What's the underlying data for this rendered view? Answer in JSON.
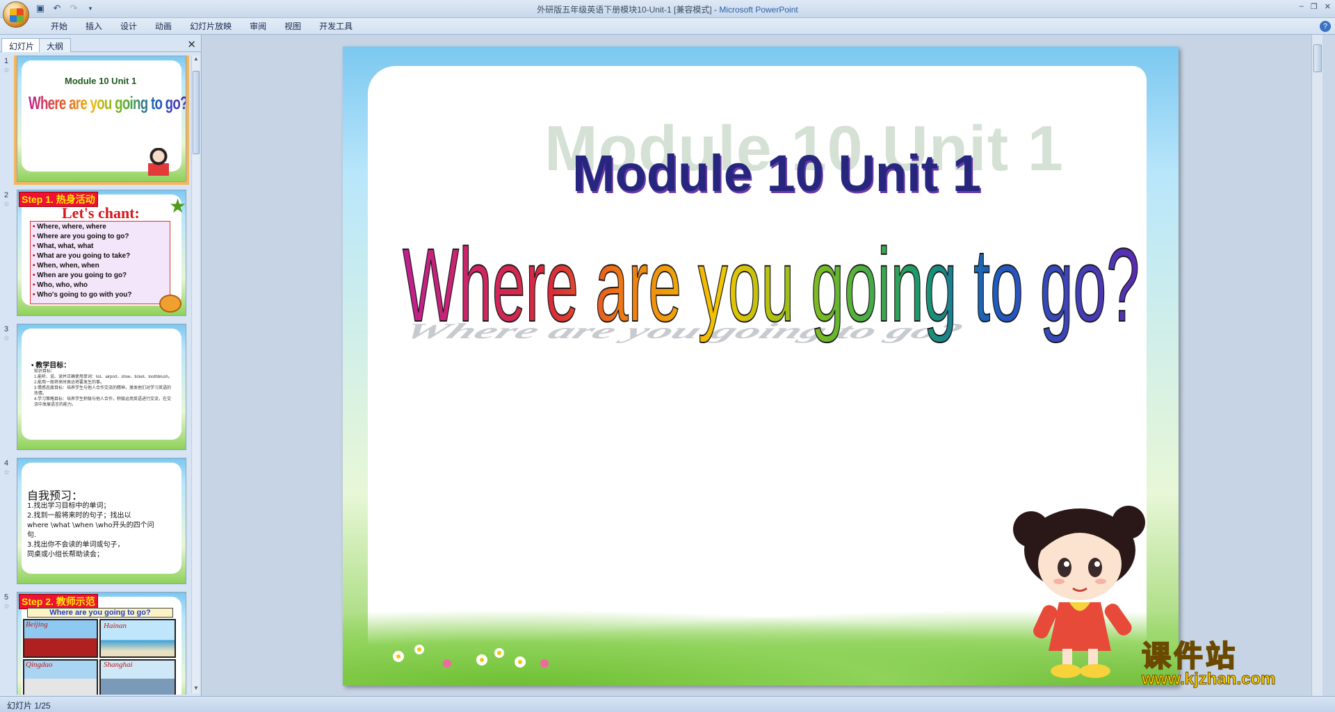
{
  "window": {
    "title": "外研版五年级英语下册模块10-Unit-1 [兼容模式]",
    "separator": " - ",
    "app": "Microsoft PowerPoint",
    "controls": [
      "–",
      "❐",
      "✕"
    ]
  },
  "ribbon": {
    "tabs": [
      "开始",
      "插入",
      "设计",
      "动画",
      "幻灯片放映",
      "审阅",
      "视图",
      "开发工具"
    ]
  },
  "left_pane": {
    "tabs": [
      "幻灯片",
      "大纲"
    ],
    "close": "✕",
    "thumbnails": [
      {
        "number": "1",
        "title_small": "Module 10  Unit  1",
        "title_big": "Where are you going  to go?"
      },
      {
        "number": "2",
        "step": "Step 1. 热身活动",
        "heading": "Let's chant:",
        "lines": [
          "Where, where, where",
          "Where are you going to go?",
          "What,  what, what",
          "What are you going to take?",
          "When,   when,  when",
          "When are you going to go?",
          "Who,  who,  who",
          "Who's going to go with you?"
        ]
      },
      {
        "number": "3",
        "heading": "• 教学目标：",
        "lines": [
          "知识目标：",
          "1.能听、说、读并正确使用单词：list、airport、shoe、ticket、toothbrush。",
          "2.能用一般将来时表达将要发生的事。",
          "3.情感态度目标：培养学生与他人合作交流的精神，激发他们对学习英语的热情。",
          "4.学习策略目标：培养学生积极与他人合作，积极运用英语进行交流，在交流中发展语言的能力。"
        ]
      },
      {
        "number": "4",
        "heading": "自我预习：",
        "lines": [
          "1.找出学习目标中的单词；",
          "2.找到一般将来时的句子；找出以",
          "where \\what \\when \\who开头的四个问",
          "句.",
          "3.找出你不会读的单词或句子，",
          "同桌或小组长帮助读会；"
        ]
      },
      {
        "number": "5",
        "step": "Step 2. 教师示范",
        "heading": "Where are you going to go?",
        "places": [
          "Beijing",
          "Hainan",
          "Qingdao",
          "Shanghai"
        ]
      }
    ]
  },
  "slide": {
    "watermark": "Module 10  Unit  1",
    "module_title": "Module 10  Unit  1",
    "main_title": "Where are you going  to go?",
    "main_title_colors": [
      "#c0208f",
      "#d92a3a",
      "#ee7a14",
      "#f2c600",
      "#6cb92a",
      "#1a9a6a",
      "#1e5cc0",
      "#5a2bb0"
    ],
    "brand_cn": "课件站",
    "brand_url": "www.kjzhan.com"
  },
  "status": {
    "slide_counter": "幻灯片 1/25"
  }
}
